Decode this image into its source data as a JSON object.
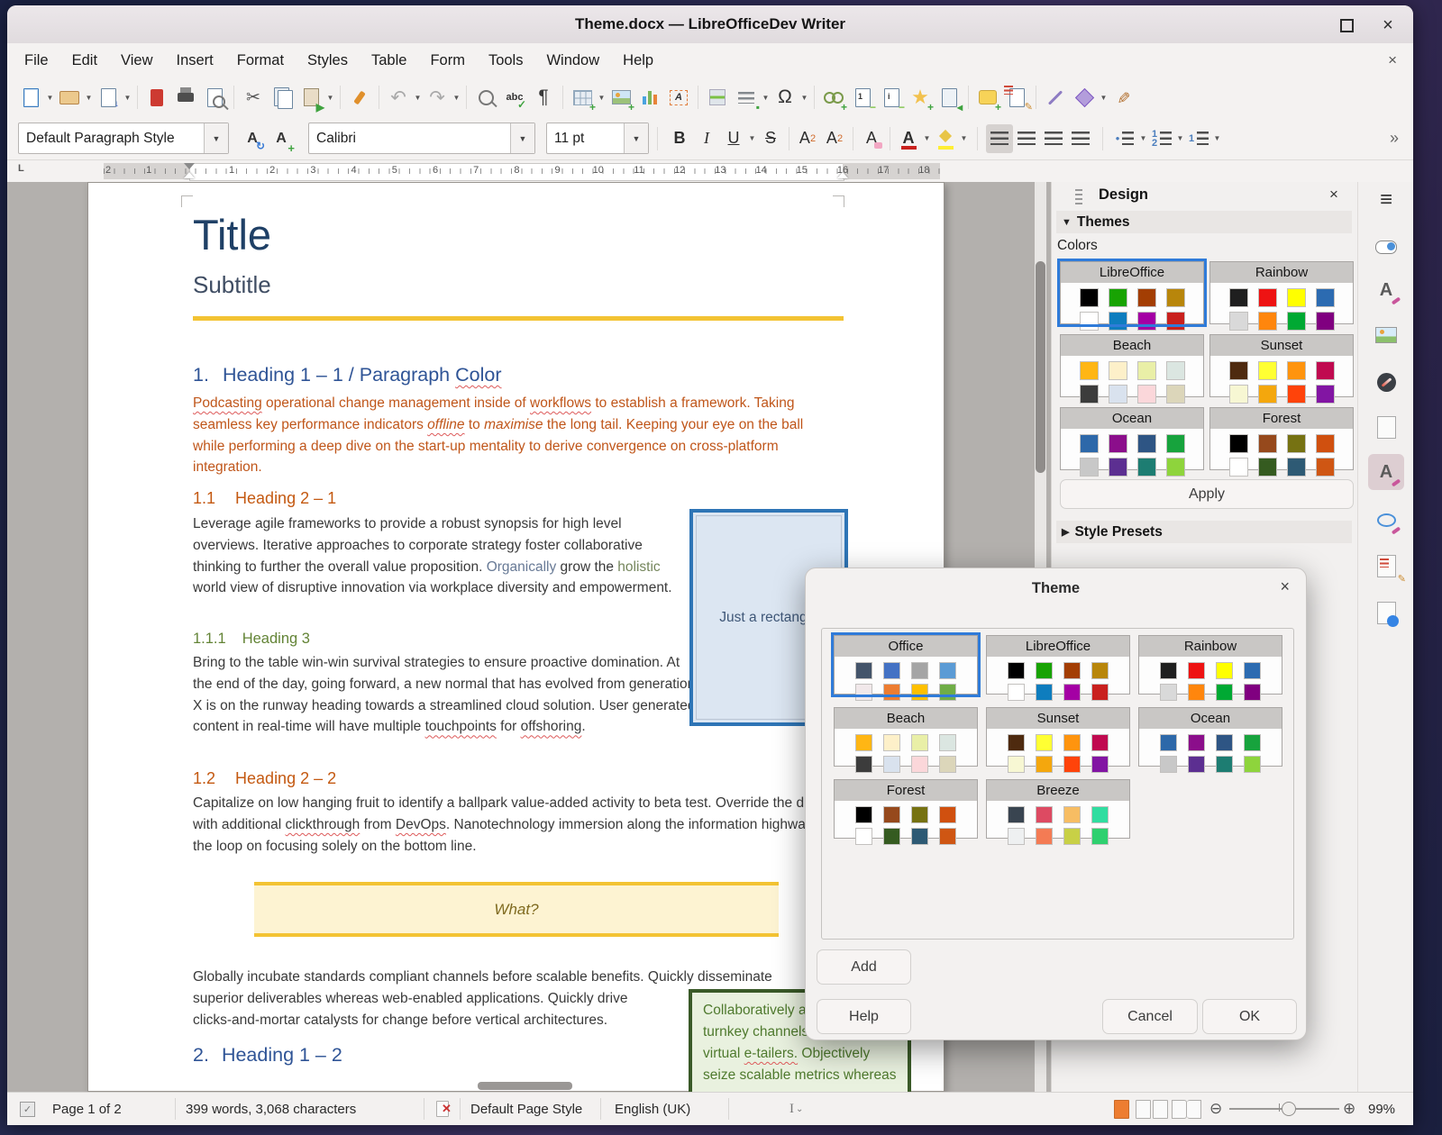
{
  "win": {
    "title": "Theme.docx — LibreOfficeDev Writer"
  },
  "menu": {
    "items": [
      "File",
      "Edit",
      "View",
      "Insert",
      "Format",
      "Styles",
      "Table",
      "Form",
      "Tools",
      "Window",
      "Help"
    ]
  },
  "toolbar": {
    "icons": [
      "new-document",
      "open",
      "save",
      "export-pdf",
      "print",
      "print-preview",
      "cut",
      "copy",
      "paste",
      "clone-formatting",
      "undo",
      "redo",
      "find-and-replace",
      "spelling",
      "formatting-marks",
      "insert-table",
      "insert-image",
      "insert-chart",
      "insert-text-box",
      "insert-page-break",
      "insert-field",
      "insert-special-character",
      "insert-hyperlink",
      "insert-footnote",
      "insert-endnote",
      "insert-bookmark",
      "insert-cross-reference",
      "insert-comment",
      "track-changes",
      "insert-line",
      "basic-shapes",
      "show-draw-functions"
    ]
  },
  "fmt": {
    "style": "Default Paragraph Style",
    "font": "Calibri",
    "size": "11 pt",
    "icons": [
      "update-style",
      "new-style",
      "bold",
      "italic",
      "underline",
      "strikethrough",
      "superscript",
      "subscript",
      "clear-formatting",
      "font-color",
      "highlighting-color",
      "align-left",
      "align-center",
      "align-right",
      "justified",
      "unordered-list",
      "ordered-list",
      "outline-list",
      "more"
    ]
  },
  "ruler": {
    "left": [
      "2",
      "1"
    ],
    "main": [
      "1",
      "2",
      "3",
      "4",
      "5",
      "6",
      "7",
      "8",
      "9",
      "10",
      "11",
      "12",
      "13",
      "14",
      "15",
      "16",
      "17",
      "18"
    ]
  },
  "doc": {
    "title": "Title",
    "subtitle": "Subtitle",
    "h1_1": {
      "num": "1.",
      "text": "Heading 1 – 1 / Paragraph ",
      "sq": "Color"
    },
    "p1": {
      "r1": "Podcasting",
      "r2": " operational change management inside of ",
      "r3": "workflows",
      "r4": " to establish a framework. Taking seamless key performance indicators ",
      "r5": "offline",
      "r6": " to ",
      "r7": "maximise",
      "r8": " the long tail. Keeping your eye on the ball while performing a deep dive on the start-up mentality to derive convergence on cross-platform integration."
    },
    "h2_1": {
      "num": "1.1",
      "text": "Heading 2 – 1"
    },
    "p2": {
      "r1": "Leverage agile frameworks to provide a robust synopsis for high level overviews. Iterative approaches to corporate strategy foster collaborative thinking to further the overall value proposition. ",
      "r2": "Organically",
      "r3": " grow the ",
      "r4": "holistic",
      "r5": " world view of disruptive innovation via workplace diversity and empowerment."
    },
    "h3": {
      "num": "1.1.1",
      "text": "Heading 3"
    },
    "p3": {
      "r1": "Bring to the table win-win survival strategies to ensure proactive domination. At the end of the day, going forward, a new normal that has evolved from generation X is on the runway heading towards a streamlined cloud solution. User generated content in real-time will have multiple ",
      "r2": "touchpoints",
      "r3": " for ",
      "r4": "offshoring",
      "r5": "."
    },
    "h2_2": {
      "num": "1.2",
      "text": "Heading 2 – 2"
    },
    "p4": {
      "r1": "Capitalize on low hanging fruit to identify a ballpark value-added activity to beta test. Override the digital divide with additional ",
      "r2": "clickthrough",
      "r3": " from ",
      "r4": "DevOps",
      "r5": ". Nanotechnology immersion along the information highway will close the loop on focusing solely on the bottom line."
    },
    "ybox": {
      "text": "What?"
    },
    "p5": {
      "l1": "Globally incubate standards compliant channels before scalable benefits. Quickly disseminate",
      "l2": "superior deliverables whereas web-enabled applications. Quickly drive",
      "l3": "clicks-and-mortar catalysts for change before vertical architectures."
    },
    "green": {
      "l1": "Collaboratively ad",
      "l2": "turnkey channels whereas",
      "l3a": "virtual ",
      "l3b": "e-tailers.",
      "l3c": " Objectively",
      "l4": "seize scalable metrics whereas"
    },
    "h1_2": {
      "num": "2.",
      "text": "Heading 1 – 2"
    },
    "shape": {
      "label": "Just a rectangle"
    }
  },
  "palettes": {
    "office": [
      "#44546a",
      "#4472c4",
      "#a5a5a5",
      "#5b9bd5",
      "#f1e8ea",
      "#ed7d31",
      "#ffc000",
      "#70ad47"
    ],
    "libreoffice": [
      "#000000",
      "#18a303",
      "#a33e03",
      "#b8860b",
      "#ffffff",
      "#0e7dbe",
      "#a400a4",
      "#c9211e"
    ],
    "rainbow": [
      "#1f1f1f",
      "#ee1313",
      "#ffff00",
      "#2c6bb1",
      "#d9d9d9",
      "#ff860d",
      "#00a933",
      "#800080"
    ],
    "beach": [
      "#ffb614",
      "#fdf0c9",
      "#e9efa7",
      "#dbe6e1",
      "#3c3c3c",
      "#d9e2ee",
      "#fbd7da",
      "#dcd6ba"
    ],
    "sunset": [
      "#4e2a0f",
      "#ffff33",
      "#ff940e",
      "#c00a50",
      "#f7f7d3",
      "#f4a70d",
      "#ff430a",
      "#8215a3"
    ],
    "ocean": [
      "#2d68a9",
      "#8b0e8b",
      "#2e5584",
      "#17a33d",
      "#c8c8c8",
      "#5c2f91",
      "#1d7d72",
      "#8ed43c"
    ],
    "forest": [
      "#000000",
      "#96491c",
      "#767212",
      "#d0500f",
      "#ffffff",
      "#355b20",
      "#2e5a74",
      "#cf5613"
    ],
    "breeze": [
      "#394450",
      "#dd4a62",
      "#f7bd63",
      "#31dda0",
      "#eef0f1",
      "#f47b54",
      "#c8d046",
      "#2fd06f"
    ]
  },
  "sidebar": {
    "title": "Design",
    "themes_label": "Themes",
    "colors_label": "Colors",
    "apply": "Apply",
    "presets": "Style Presets",
    "cards": [
      {
        "name": "LibreOffice"
      },
      {
        "name": "Rainbow"
      },
      {
        "name": "Beach"
      },
      {
        "name": "Sunset"
      },
      {
        "name": "Ocean"
      },
      {
        "name": "Forest"
      }
    ],
    "tabs": [
      "sidebar-menu",
      "properties",
      "styles",
      "gallery",
      "navigator",
      "page",
      "design",
      "style-inspector",
      "manage-changes",
      "accessibility-check"
    ]
  },
  "dialog": {
    "title": "Theme",
    "cards": [
      {
        "name": "Office"
      },
      {
        "name": "LibreOffice"
      },
      {
        "name": "Rainbow"
      },
      {
        "name": "Beach"
      },
      {
        "name": "Sunset"
      },
      {
        "name": "Ocean"
      },
      {
        "name": "Forest"
      },
      {
        "name": "Breeze"
      }
    ],
    "add": "Add",
    "help": "Help",
    "cancel": "Cancel",
    "ok": "OK"
  },
  "status": {
    "page": "Page 1 of 2",
    "words": "399 words, 3,068 characters",
    "style": "Default Page Style",
    "lang": "English (UK)",
    "zoom": "99%"
  }
}
